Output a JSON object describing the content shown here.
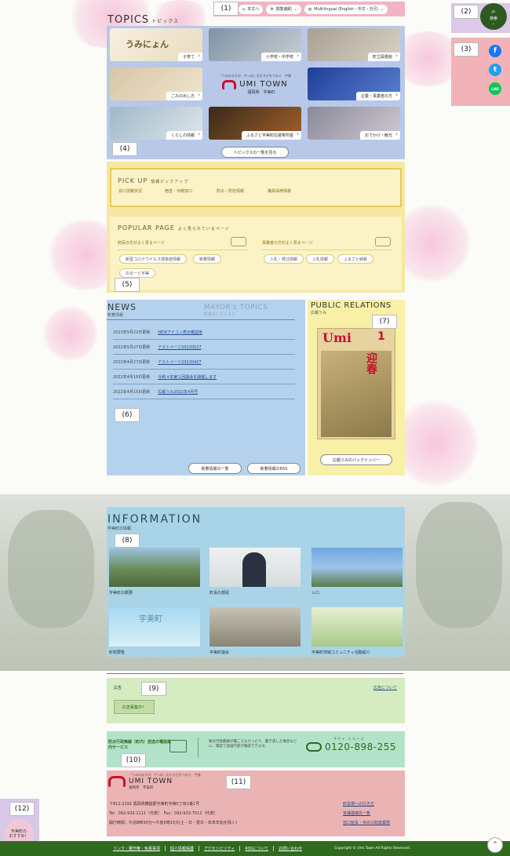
{
  "regions": [
    "(1)",
    "(2)",
    "(3)",
    "(4)",
    "(5)",
    "(6)",
    "(7)",
    "(8)",
    "(9)",
    "(10)",
    "(11)",
    "(12)"
  ],
  "utility": {
    "to_main": "本文へ",
    "view_assist": "閲覧補助",
    "multilingual": "Multilingual (English・中文・한국)"
  },
  "search": {
    "label": "検索"
  },
  "sns": {
    "facebook": "f",
    "twitter": "t",
    "line": "LINE"
  },
  "topics": {
    "title": "TOPICS",
    "subtitle": "トピックス",
    "tiles": [
      "子育て",
      "小学校・中学校",
      "町立図書館",
      "ごみの出し方",
      "企業・事業者の方",
      "くらしの情報",
      "ふるさと宇美町応援寄附金",
      "おでかけ・観光"
    ],
    "umi_app_text": "うみにょん",
    "more_button": "トピックスの一覧を見る"
  },
  "town_logo": {
    "catch": "「うみのまちが、やっぱ」おむすびをつなぐ　宇美",
    "name": "UMI TOWN",
    "sub": "福岡県　宇美町"
  },
  "pickup": {
    "title": "PICK UP",
    "subtitle": "情報ピックアップ",
    "links": [
      "窓口混雑状況",
      "宿直・日曜窓口",
      "防災・防犯情報",
      "職員採用情報"
    ]
  },
  "popular": {
    "title": "POPULAR PAGE",
    "subtitle": "よく見られているページ",
    "residents": {
      "heading": "町民の方がよく見るページ",
      "tags": [
        "新型コロナウイルス感染症情報",
        "新着情報",
        "のるーと宇美"
      ]
    },
    "business": {
      "heading": "事業者の方がよく見るページ",
      "tags": [
        "入札・発注情報",
        "入札情報",
        "ふるさと納税"
      ]
    }
  },
  "news": {
    "title": "NEWS",
    "subtitle": "新着情報",
    "mayor_title": "MAYOR's TOPICS",
    "mayor_subtitle": "町長のトピックス",
    "items": [
      {
        "date": "2023年5月22日更新",
        "title": "NEWアイコン表示確認用"
      },
      {
        "date": "2022年5月27日更新",
        "title": "テストページ20220527"
      },
      {
        "date": "2022年4月27日更新",
        "title": "テストページ20220427"
      },
      {
        "date": "2022年4月18日更新",
        "title": "令和４年第２回議会を開催します"
      },
      {
        "date": "2022年4月15日更新",
        "title": "広報うみ2022年4月号"
      }
    ],
    "list_button": "新着情報の一覧",
    "rss_button": "新着情報のRSS"
  },
  "pr": {
    "title": "PUBLIC RELATIONS",
    "subtitle": "広報うみ",
    "magazine_name": "Umi",
    "magazine_issue": "1",
    "magazine_headline": "迎春",
    "backnumber_button": "広報うみのバックナンバー"
  },
  "information": {
    "title": "INFORMATION",
    "subtitle": "宇美町の情報",
    "items": [
      "宇美町の概要",
      "町長の部屋",
      "入口",
      "町勢要覧",
      "宇美町議会",
      "宇美町地域コミュニティ活動紹介"
    ],
    "photo_text": "宇美町"
  },
  "ads": {
    "label": "広告",
    "about_link": "広告について",
    "banner_text": "広告募集中！"
  },
  "bousai": {
    "title": "防災行政無線（町内）放送の電話案内サービス",
    "desc": "防災行政無線が聞こえなかったり、聞き逃した場合などに、電話で放送内容が確認できます。",
    "ruby": "サ ケ イ　ニ ゴ ー ゴ",
    "phone": "0120-898-255"
  },
  "footer": {
    "address": "〒811-2192 福岡県糟屋郡宇美町宇美5丁目1番1号",
    "tel": "Tel：092-932-1111（代表）　Fax：092-933-7512（代表）",
    "hours": "開庁時間：午前8時30分～午後5時15分(土・日・祝日・年末年始を除く)",
    "links": [
      "町役場への行き方",
      "各課連絡先一覧",
      "窓口延長・休日の取扱業務"
    ]
  },
  "recommend": {
    "line1": "宇美町の",
    "line2": "おすすめ！"
  },
  "bottombar": {
    "links": [
      "リンク・著作権・免責事項",
      "個人情報保護",
      "アクセシビリティ",
      "RSSについて",
      "お問い合わせ"
    ],
    "copyright": "Copyright © Umi Town All Rights Reserved."
  },
  "colors": {
    "brand_green": "#2f6a1f",
    "brand_red": "#c8102e",
    "region1": "#f2b3c2",
    "region4": "#b8c8e8",
    "region5": "#f7e7a0",
    "region6": "#b4d2ee",
    "region7": "#f9f0a8",
    "region8": "#a9d4e8",
    "region9": "#d4ecc0",
    "region10": "#b2e3c9",
    "region11": "#ebb4b4"
  },
  "icons": [
    "home-icon",
    "gear-icon",
    "globe-icon",
    "search-icon",
    "facebook-icon",
    "twitter-icon",
    "line-icon",
    "arrow-up-icon",
    "phone-free-icon"
  ]
}
